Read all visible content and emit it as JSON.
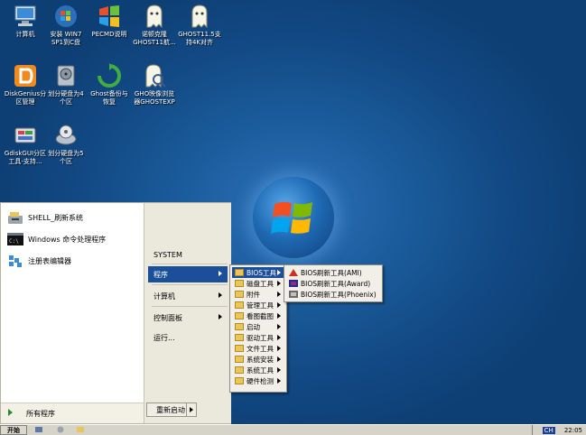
{
  "desktop": {
    "icons": [
      {
        "label": "计算机",
        "name": "computer-icon"
      },
      {
        "label": "安装 WIN7\nSP1到C盘",
        "name": "windows-install-icon"
      },
      {
        "label": "PECMD说明",
        "name": "pecmd-help-icon"
      },
      {
        "label": "诺顿克隆\nGHOST11航...",
        "name": "ghost11-icon"
      },
      {
        "label": "GHOST11.5支\n持4K对齐",
        "name": "ghost115-icon"
      },
      {
        "label": "DiskGenius分\n区管理",
        "name": "diskgenius-icon"
      },
      {
        "label": "划分硬盘为4\n个区",
        "name": "partition4-icon"
      },
      {
        "label": "Ghost备份与\n恢复",
        "name": "ghost-backup-icon"
      },
      {
        "label": "GHO映像浏览\n器GHOSTEXP",
        "name": "ghostexp-icon"
      },
      {
        "label": "GdiskGUI分区\n工具-支持...",
        "name": "gdiskgui-icon"
      },
      {
        "label": "划分硬盘为5\n个区",
        "name": "partition5-icon"
      }
    ]
  },
  "start_menu": {
    "pinned": [
      {
        "label": "SHELL_刷新系统"
      },
      {
        "label": "Windows 命令处理程序"
      },
      {
        "label": "注册表编辑器"
      }
    ],
    "all_programs": "所有程序",
    "right": {
      "system": "SYSTEM",
      "programs": "程序",
      "computer": "计算机",
      "control_panel": "控制面板",
      "run": "运行..."
    },
    "restart": "重新启动"
  },
  "programs_submenu": {
    "items": [
      "BIOS工具",
      "磁盘工具",
      "附件",
      "管理工具",
      "看图截图",
      "启动",
      "驱动工具",
      "文件工具",
      "系统安装",
      "系统工具",
      "硬件检测"
    ]
  },
  "bios_submenu": {
    "items": [
      "BIOS刷新工具(AMI)",
      "BIOS刷新工具(Award)",
      "BIOS刷新工具(Phoenix)"
    ]
  },
  "taskbar": {
    "start_label": "开始",
    "clock": "22:05",
    "lang": "CH"
  }
}
